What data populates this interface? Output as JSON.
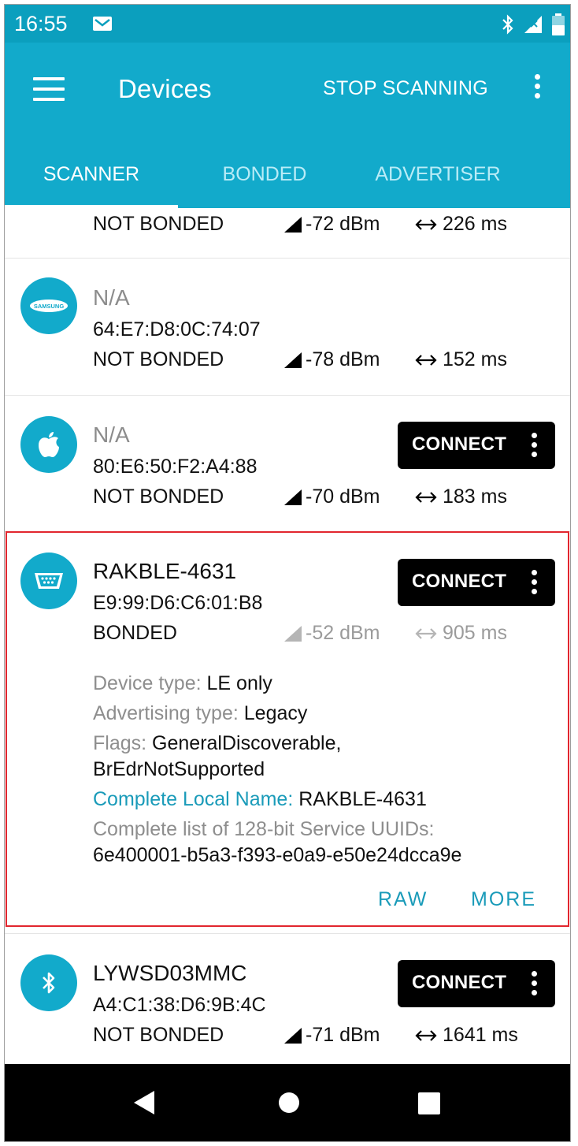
{
  "status": {
    "time": "16:55",
    "icons": [
      "mail-icon",
      "bluetooth-icon",
      "signal-icon",
      "battery-icon"
    ]
  },
  "appbar": {
    "title": "Devices",
    "action": "STOP SCANNING",
    "tabs": [
      "SCANNER",
      "BONDED",
      "ADVERTISER"
    ],
    "active_tab": "SCANNER"
  },
  "list": {
    "partial_row": {
      "bond": "NOT BONDED",
      "rssi": "-72 dBm",
      "interval": "226 ms"
    },
    "devices": [
      {
        "icon": "samsung-icon",
        "name": "N/A",
        "address": "64:E7:D8:0C:74:07",
        "bond": "NOT BONDED",
        "rssi": "-78 dBm",
        "interval": "152 ms"
      },
      {
        "icon": "apple-icon",
        "name": "N/A",
        "address": "80:E6:50:F2:A4:88",
        "bond": "NOT BONDED",
        "rssi": "-70 dBm",
        "interval": "183 ms",
        "button": "CONNECT"
      },
      {
        "icon": "serial-port-icon",
        "name": "RAKBLE-4631",
        "address": "E9:99:D6:C6:01:B8",
        "bond": "BONDED",
        "rssi": "-52 dBm",
        "interval": "905 ms",
        "button": "CONNECT",
        "details": {
          "device_type_label": "Device type:",
          "device_type": "LE only",
          "adv_type_label": "Advertising type:",
          "adv_type": "Legacy",
          "flags_label": "Flags:",
          "flags_1": "GeneralDiscoverable,",
          "flags_2": "BrEdrNotSupported",
          "local_name_label": "Complete Local Name:",
          "local_name": "RAKBLE-4631",
          "uuids_label": "Complete list of 128-bit Service UUIDs:",
          "uuids": "6e400001-b5a3-f393-e0a9-e50e24dcca9e"
        },
        "actions": [
          "RAW",
          "MORE"
        ]
      },
      {
        "icon": "bluetooth-icon",
        "name": "LYWSD03MMC",
        "address": "A4:C1:38:D6:9B:4C",
        "bond": "NOT BONDED",
        "rssi": "-71 dBm",
        "interval": "1641 ms",
        "button": "CONNECT"
      }
    ]
  },
  "navbar": {
    "buttons": [
      "back-icon",
      "home-icon",
      "recents-icon"
    ]
  },
  "colors": {
    "primary": "#12aacb",
    "status_bar": "#0b9fbe",
    "highlight": "#e2262e",
    "link": "#1a9bb9"
  }
}
